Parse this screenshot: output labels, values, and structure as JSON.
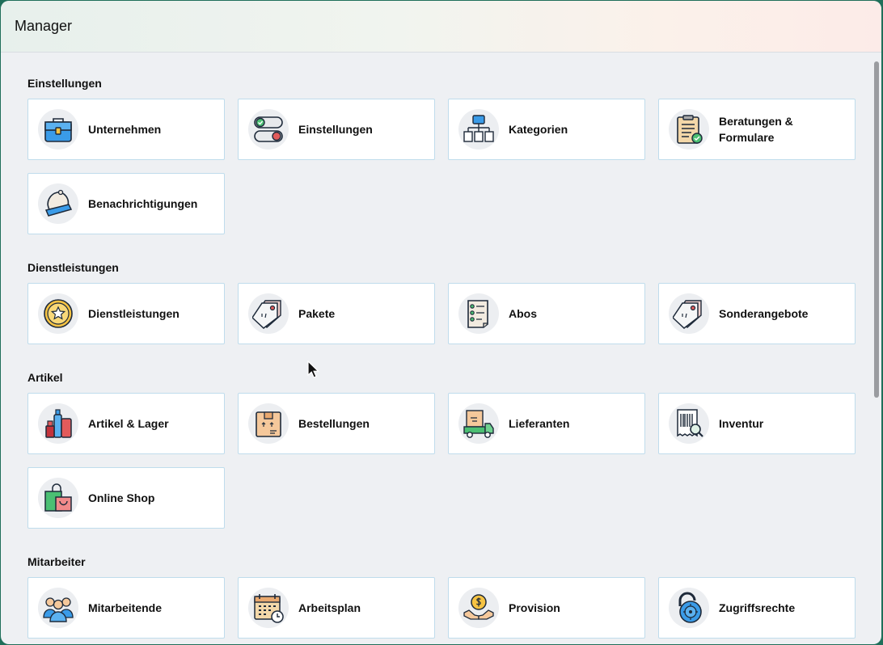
{
  "window": {
    "title": "Manager"
  },
  "sections": [
    {
      "title": "Einstellungen",
      "items": [
        {
          "label": "Unternehmen",
          "icon": "briefcase-icon"
        },
        {
          "label": "Einstellungen",
          "icon": "toggle-switches-icon"
        },
        {
          "label": "Kategorien",
          "icon": "hierarchy-icon"
        },
        {
          "label": "Beratungen & Formulare",
          "icon": "clipboard-check-icon"
        },
        {
          "label": "Benachrichtigungen",
          "icon": "bell-icon"
        }
      ]
    },
    {
      "title": "Dienstleistungen",
      "items": [
        {
          "label": "Dienstleistungen",
          "icon": "star-badge-icon"
        },
        {
          "label": "Pakete",
          "icon": "price-tag-icon"
        },
        {
          "label": "Abos",
          "icon": "checklist-icon"
        },
        {
          "label": "Sonderangebote",
          "icon": "price-tag-icon"
        }
      ]
    },
    {
      "title": "Artikel",
      "items": [
        {
          "label": "Artikel & Lager",
          "icon": "cosmetics-icon"
        },
        {
          "label": "Bestellungen",
          "icon": "package-box-icon"
        },
        {
          "label": "Lieferanten",
          "icon": "delivery-truck-icon"
        },
        {
          "label": "Inventur",
          "icon": "barcode-receipt-icon"
        },
        {
          "label": "Online Shop",
          "icon": "shopping-bags-icon"
        }
      ]
    },
    {
      "title": "Mitarbeiter",
      "items": [
        {
          "label": "Mitarbeitende",
          "icon": "people-group-icon"
        },
        {
          "label": "Arbeitsplan",
          "icon": "calendar-clock-icon"
        },
        {
          "label": "Provision",
          "icon": "coin-hands-icon"
        },
        {
          "label": "Zugriffsrechte",
          "icon": "combination-lock-icon"
        }
      ]
    }
  ],
  "colors": {
    "card_border": "#bfdcec",
    "background": "#eef0f3",
    "icon_circle": "#eceef1"
  }
}
